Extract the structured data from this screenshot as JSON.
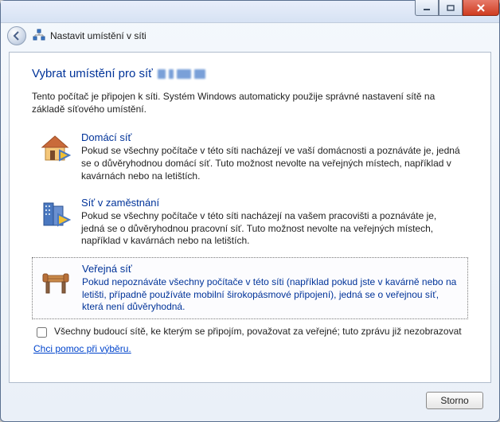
{
  "window": {
    "nav_title": "Nastavit umístění v síti"
  },
  "page": {
    "heading": "Vybrat umístění pro síť",
    "intro": "Tento počítač je připojen k síti. Systém Windows automaticky použije správné nastavení sítě na základě síťového umístění."
  },
  "options": {
    "home": {
      "title": "Domácí síť",
      "desc": "Pokud se všechny počítače v této síti nacházejí ve vaší domácnosti a poznáváte je, jedná se o důvěryhodnou domácí síť. Tuto možnost nevolte na veřejných místech, například v kavárnách nebo na letištích."
    },
    "work": {
      "title": "Síť v zaměstnání",
      "desc": "Pokud se všechny počítače v této síti nacházejí na vašem pracovišti a poznáváte je, jedná se o důvěryhodnou pracovní síť. Tuto možnost nevolte na veřejných místech, například v kavárnách nebo na letištích."
    },
    "public": {
      "title": "Veřejná síť",
      "desc": "Pokud nepoznáváte všechny počítače v této síti (například pokud jste v kavárně nebo na letišti, případně používáte mobilní širokopásmové připojení), jedná se o veřejnou síť, která není důvěryhodná."
    }
  },
  "checkbox": {
    "label": "Všechny budoucí sítě, ke kterým se připojím, považovat za veřejné; tuto zprávu již nezobrazovat"
  },
  "links": {
    "help": "Chci pomoc při výběru."
  },
  "buttons": {
    "cancel": "Storno"
  }
}
